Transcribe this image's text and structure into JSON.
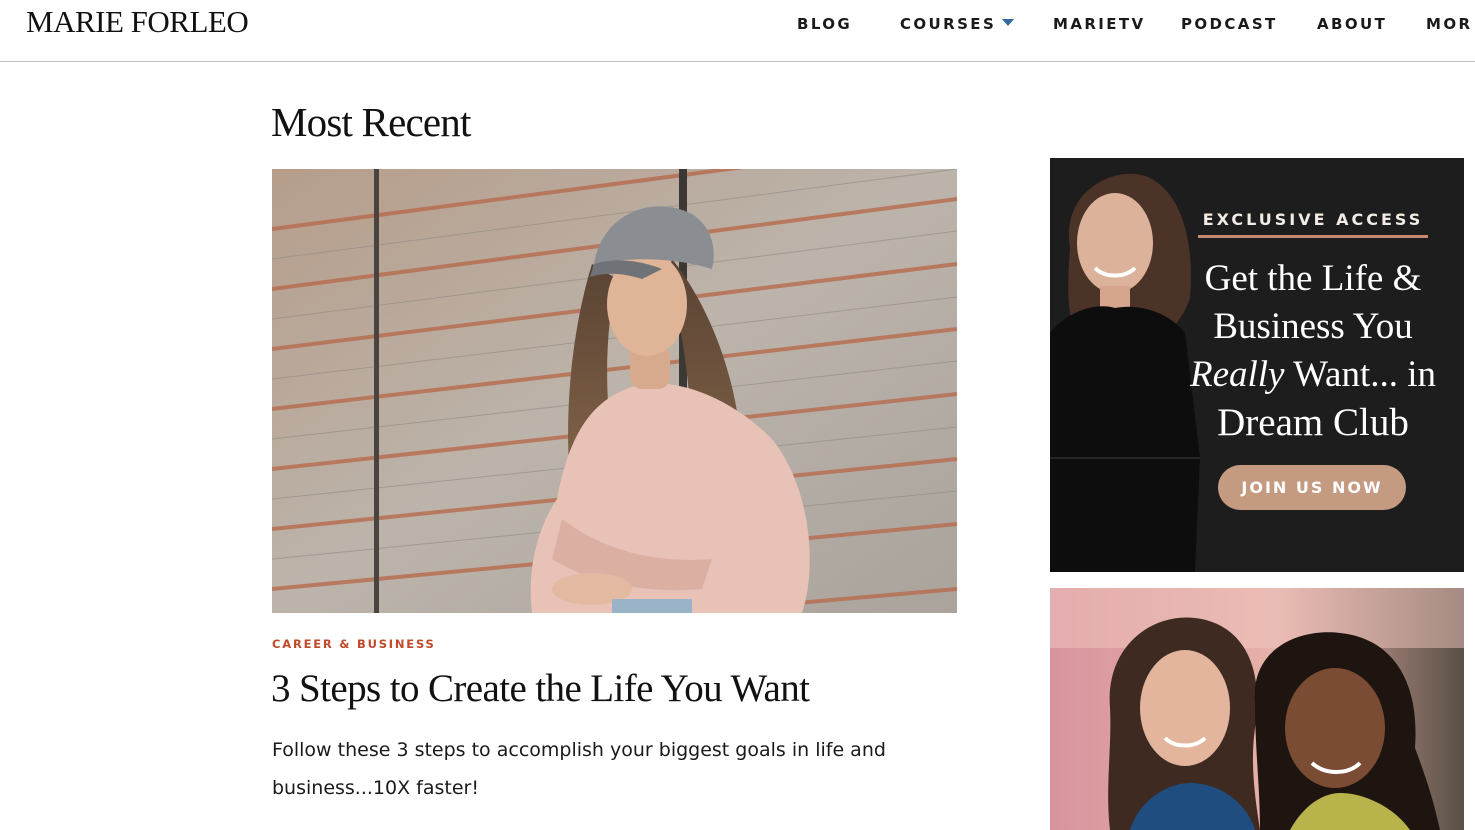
{
  "header": {
    "logo": "MARIE FORLEO",
    "nav": [
      {
        "label": "BLOG"
      },
      {
        "label": "COURSES",
        "has_dropdown": true
      },
      {
        "label": "MARIETV"
      },
      {
        "label": "PODCAST"
      },
      {
        "label": "ABOUT"
      },
      {
        "label": "MOR"
      }
    ]
  },
  "main": {
    "section_title": "Most Recent",
    "featured_post": {
      "category": "CAREER & BUSINESS",
      "title": "3 Steps to Create the Life You Want",
      "excerpt": "Follow these 3 steps to accomplish your biggest goals in life and business...10X faster!"
    }
  },
  "sidebar": {
    "ad_dream_club": {
      "eyebrow": "EXCLUSIVE ACCESS",
      "headline_line1": "Get the Life &",
      "headline_line2": "Business You",
      "headline_italic": "Really",
      "headline_line3_rest": " Want... in",
      "headline_line4": "Dream Club",
      "cta": "JOIN US NOW"
    }
  },
  "colors": {
    "category_accent": "#c0492b",
    "nav_caret": "#2f6aa0",
    "ad_background": "#1d1d1d",
    "ad_rule": "#c9896d",
    "ad_button": "#c49a80"
  }
}
